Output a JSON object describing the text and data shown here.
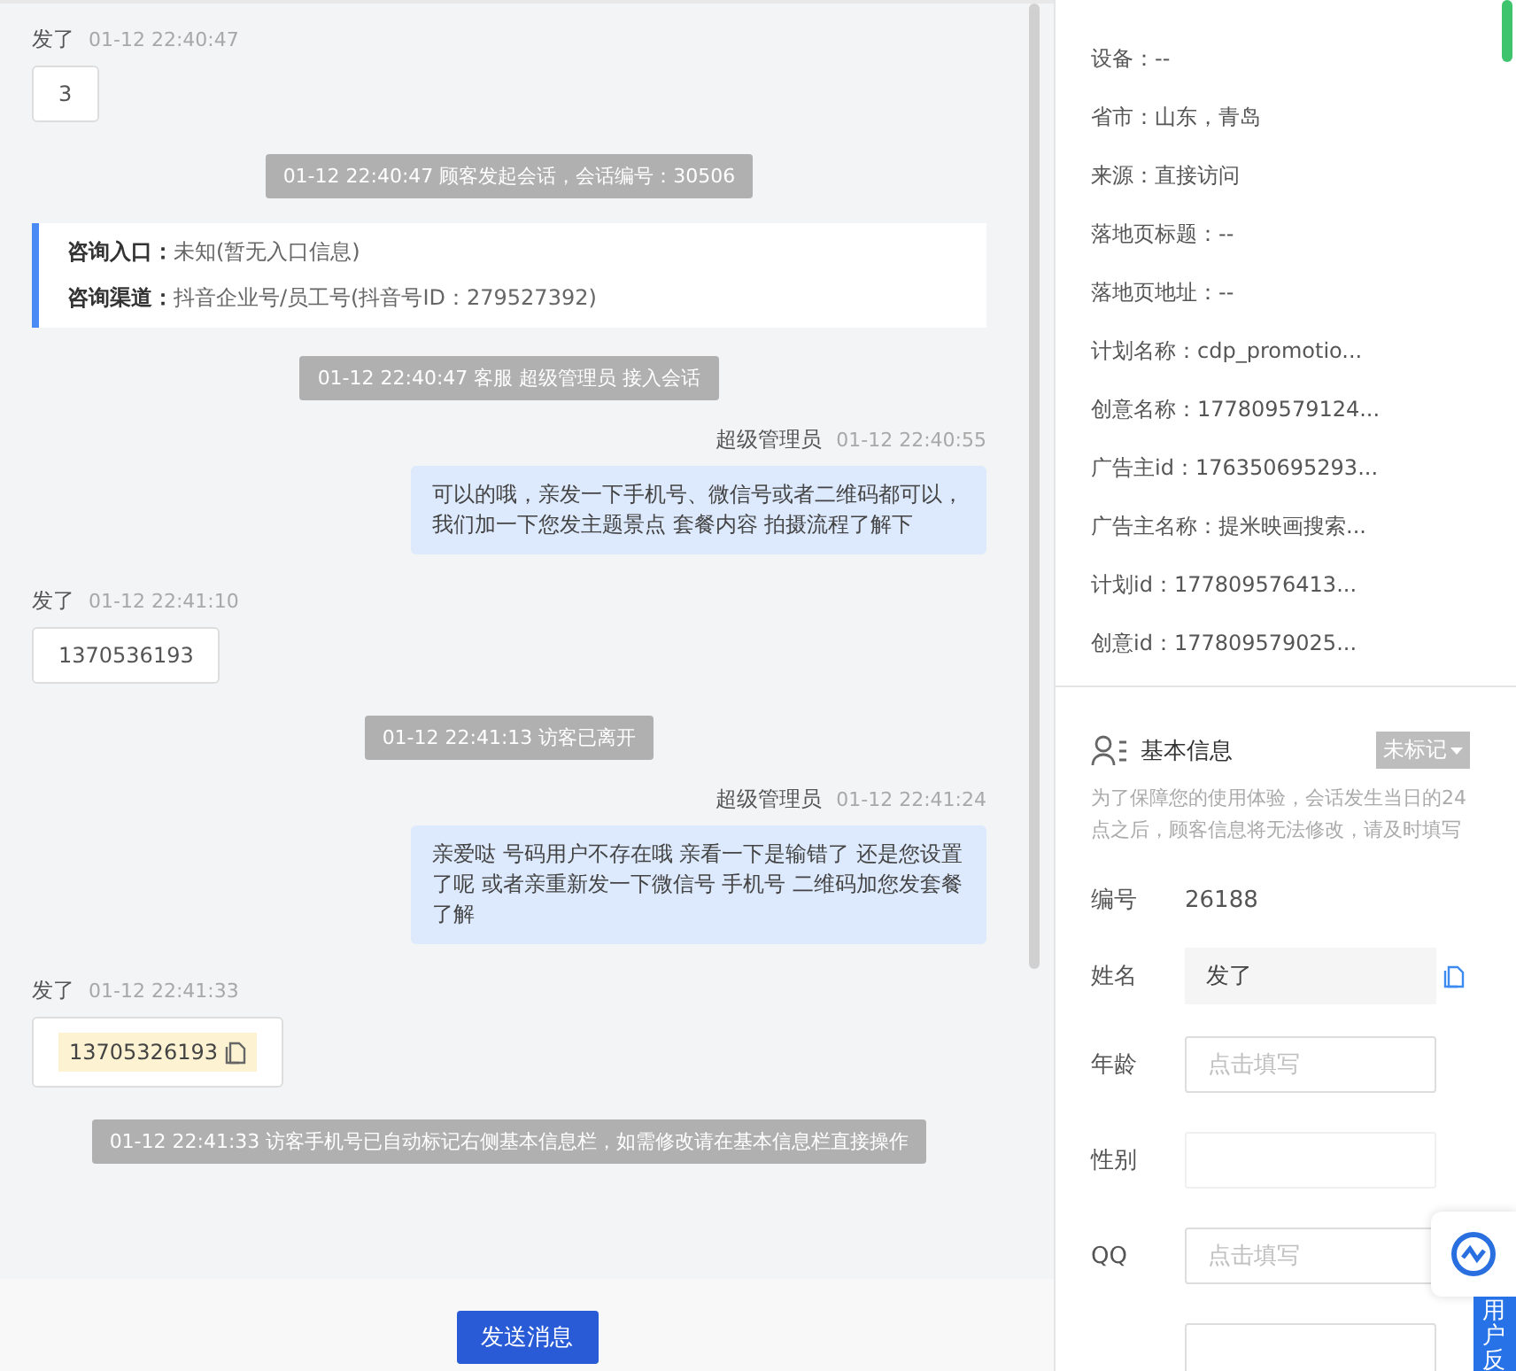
{
  "chat": {
    "messages": [
      {
        "kind": "customer",
        "sender": "发了",
        "time": "01-12 22:40:47",
        "text": "3"
      },
      {
        "kind": "system",
        "text": "01-12 22:40:47 顾客发起会话，会话编号：30506"
      },
      {
        "kind": "info",
        "lines": [
          {
            "label": "咨询入口：",
            "value": "未知(暂无入口信息)"
          },
          {
            "label": "咨询渠道：",
            "value": "抖音企业号/员工号(抖音号ID：279527392)"
          }
        ]
      },
      {
        "kind": "system",
        "text": "01-12 22:40:47 客服 超级管理员 接入会话"
      },
      {
        "kind": "agent",
        "sender": "超级管理员",
        "time": "01-12 22:40:55",
        "text": "可以的哦，亲发一下手机号、微信号或者二维码都可以，我们加一下您发主题景点 套餐内容 拍摄流程了解下"
      },
      {
        "kind": "customer",
        "sender": "发了",
        "time": "01-12 22:41:10",
        "text": "1370536193"
      },
      {
        "kind": "system",
        "text": "01-12 22:41:13 访客已离开"
      },
      {
        "kind": "agent",
        "sender": "超级管理员",
        "time": "01-12 22:41:24",
        "text": "亲爱哒 号码用户不存在哦 亲看一下是输错了 还是您设置了呢 或者亲重新发一下微信号 手机号 二维码加您发套餐了解"
      },
      {
        "kind": "phone",
        "sender": "发了",
        "time": "01-12 22:41:33",
        "text": "13705326193"
      },
      {
        "kind": "system",
        "text": "01-12 22:41:33 访客手机号已自动标记右侧基本信息栏，如需修改请在基本信息栏直接操作"
      }
    ],
    "send_button": "发送消息"
  },
  "source_info": {
    "fields": [
      "设备：--",
      "省市：山东，青岛",
      "来源：直接访问",
      "落地页标题：--",
      "落地页地址：--",
      "计划名称：cdp_promotio...",
      "创意名称：177809579124...",
      "广告主id：176350695293...",
      "广告主名称：提米映画搜索...",
      "计划id：177809576413...",
      "创意id：177809579025..."
    ]
  },
  "basic_info": {
    "title": "基本信息",
    "tag": "未标记",
    "note": "为了保障您的使用体验，会话发生当日的24点之后，顾客信息将无法修改，请及时填写",
    "fields": [
      {
        "kind": "text",
        "label": "编号",
        "value": "26188"
      },
      {
        "kind": "filled",
        "label": "姓名",
        "value": "发了"
      },
      {
        "kind": "input",
        "label": "年龄",
        "placeholder": "点击填写"
      },
      {
        "kind": "empty",
        "label": "性别"
      },
      {
        "kind": "input",
        "label": "QQ",
        "placeholder": "点击填写"
      },
      {
        "kind": "input"
      }
    ]
  },
  "feedback_tab": "用户反"
}
